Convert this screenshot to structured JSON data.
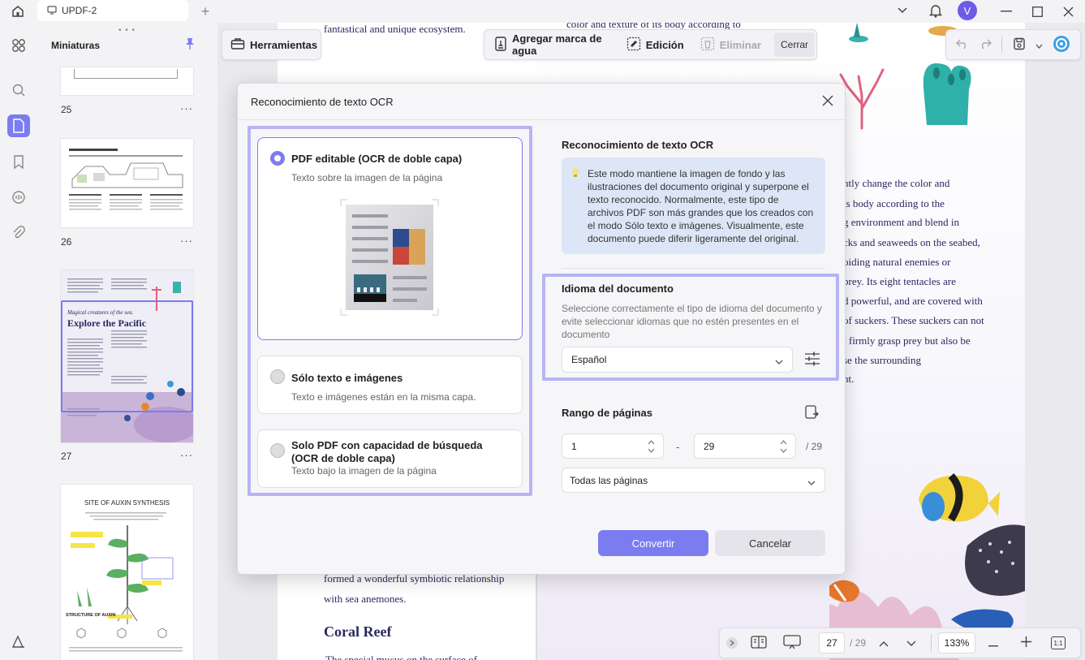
{
  "colors": {
    "accent": "#7b7cf0",
    "highlight": "#b7b4f5",
    "infoBg": "#dde6f6",
    "docText": "#2a2860"
  },
  "titlebar": {
    "tab_label": "UPDF-2",
    "avatar_letter": "V"
  },
  "thumbs": {
    "title": "Miniaturas",
    "pages": [
      {
        "num": "25"
      },
      {
        "num": "26"
      },
      {
        "num": "27",
        "heading_small": "Magical creatures of the sea.",
        "heading": "Explore the Pacific"
      },
      {
        "num": "",
        "title": "SITE OF AUXIN SYNTHESIS",
        "subtitle": "STRUCTURE OF AUXIN"
      }
    ]
  },
  "toolbar": {
    "tools_label": "Herramientas",
    "watermark_label": "Agregar marca de agua",
    "edit_label": "Edición",
    "delete_label": "Eliminar",
    "close_label": "Cerrar"
  },
  "doc": {
    "top_left": "fantastical and unique ecosystem.",
    "top_right": "color and texture of its body according to",
    "right_lines": [
      "ntly change the color and",
      "ts body according to the",
      "g environment and blend in",
      "cks and seaweeds on the seabed,",
      "oiding natural enemies or",
      " prey. Its eight tentacles are",
      "d powerful, and are covered with",
      " of suckers. These suckers can not",
      "t firmly grasp prey but also be",
      "se the surrounding",
      "nt."
    ],
    "bottom_lines": [
      "formed a wonderful symbiotic relationship",
      "with sea anemones."
    ],
    "heading": "Coral Reef",
    "last_line": "The special mucus on the surface of"
  },
  "modal": {
    "title": "Reconocimiento de texto OCR",
    "options": [
      {
        "title": "PDF editable (OCR de doble capa)",
        "sub": "Texto sobre la imagen de la página"
      },
      {
        "title": "Sólo texto e imágenes",
        "sub": "Texto e imágenes están en la misma capa."
      },
      {
        "title": "Solo PDF con capacidad de búsqueda (OCR de doble capa)",
        "sub": "Texto bajo la imagen de la página"
      }
    ],
    "right_title": "Reconocimiento de texto OCR",
    "info": "Este modo mantiene la imagen de fondo y las ilustraciones del documento original y superpone el texto reconocido. Normalmente, este tipo de archivos PDF son más grandes que los creados con el modo Sólo texto e imágenes. Visualmente, este documento puede diferir ligeramente del original.",
    "lang_title": "Idioma del documento",
    "lang_desc": "Seleccione correctamente el tipo de idioma del documento y evite seleccionar idiomas que no estén presentes en el documento",
    "lang_value": "Español",
    "range_title": "Rango de páginas",
    "range_from": "1",
    "range_to": "29",
    "range_total": "/ 29",
    "range_select": "Todas las páginas",
    "convert": "Convertir",
    "cancel": "Cancelar"
  },
  "bottombar": {
    "page": "27",
    "total": "/ 29",
    "zoom": "133%",
    "fit": "1:1"
  }
}
